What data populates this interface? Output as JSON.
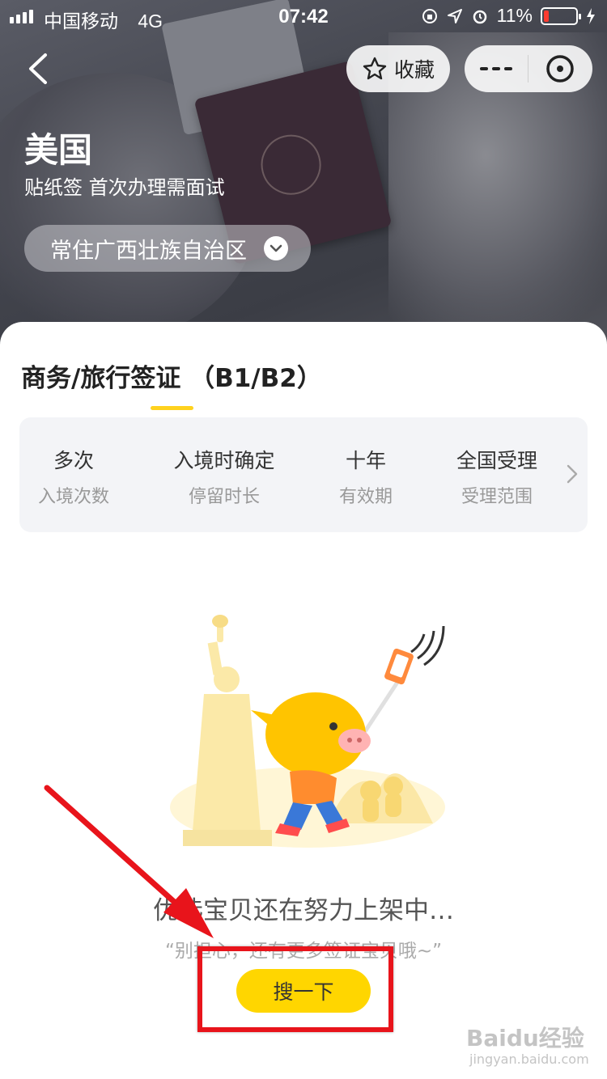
{
  "status_bar": {
    "carrier": "中国移动",
    "network": "4G",
    "time": "07:42",
    "battery": "11%"
  },
  "nav": {
    "favorite_label": "收藏"
  },
  "header": {
    "country": "美国",
    "visa_desc": "贴纸签 首次办理需面试",
    "region": "常住广西壮族自治区"
  },
  "visa": {
    "tab_label": "商务/旅行签证 （B1/B2）",
    "info": [
      {
        "value": "多次",
        "label": "入境次数"
      },
      {
        "value": "入境时确定",
        "label": "停留时长"
      },
      {
        "value": "十年",
        "label": "有效期"
      },
      {
        "value": "全国受理",
        "label": "受理范围"
      }
    ]
  },
  "empty_state": {
    "title": "优选宝贝还在努力上架中…",
    "subtitle": "“别担心，还有更多签证宝贝哦~”",
    "button": "搜一下"
  },
  "watermark": {
    "logo": "Baidu经验",
    "url": "jingyan.baidu.com"
  },
  "colors": {
    "accent_yellow": "#ffd600",
    "highlight_red": "#e8141b",
    "battery_low": "#ff3b30"
  }
}
